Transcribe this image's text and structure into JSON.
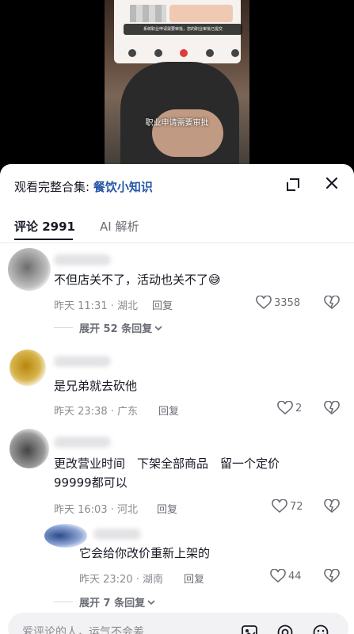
{
  "video": {
    "popup_text": "系统职业申请需要审批，您的职业审批已提交",
    "caption": "职业申请需要审批"
  },
  "sheet": {
    "collection_prefix": "观看完整合集: ",
    "collection_name": "餐饮小知识"
  },
  "tabs": {
    "comments": "评论 2991",
    "ai": "AI 解析"
  },
  "comments": [
    {
      "text": "不但店关不了，活动也关不了😅",
      "time_loc": "昨天 11:31 · 湖北",
      "reply": "回复",
      "likes": "3358",
      "more": "展开 52 条回复",
      "chevron": "chevron-down-icon"
    },
    {
      "text": "是兄弟就去砍他",
      "time_loc": "昨天 23:38 · 广东",
      "reply": "回复",
      "likes": "2"
    },
    {
      "text_line1": "更改营业时间　下架全部商品　留一个定价",
      "text_line2": "99999都可以",
      "time_loc": "昨天 16:03 · 河北",
      "reply": "回复",
      "likes": "72"
    },
    {
      "text": "它会给你改价重新上架的",
      "time_loc": "昨天 23:20 · 湖南",
      "reply": "回复",
      "likes": "44",
      "more": "展开 7 条回复"
    }
  ],
  "input": {
    "placeholder": "爱评论的人，运气不会差"
  },
  "colors": {
    "accent_link": "#2557a7",
    "text_primary": "#161823",
    "text_secondary": "#8a8b91"
  }
}
